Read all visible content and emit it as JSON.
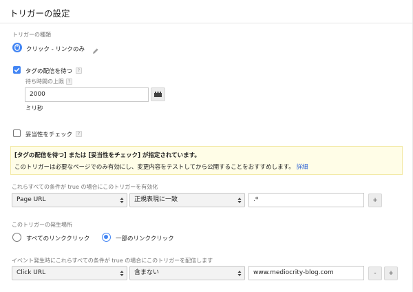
{
  "header": {
    "title": "トリガーの設定"
  },
  "trigger_type": {
    "section_label": "トリガーの種類",
    "value": "クリック - リンクのみ"
  },
  "wait_for_tags": {
    "label": "タグの配信を待つ",
    "checked": true,
    "max_wait_label": "待ち時間の上限",
    "max_wait_value": "2000",
    "unit": "ミリ秒"
  },
  "check_validation": {
    "label": "妥当性をチェック",
    "checked": false
  },
  "help_mark": "?",
  "notice": {
    "title": "[タグの配信を待つ] または [妥当性をチェック] が指定されています。",
    "body": "このトリガーは必要なページでのみ有効にし、変更内容をテストしてから公開することをおすすめします。",
    "link": "詳細"
  },
  "enable_conditions": {
    "label": "これらすべての条件が true の場合にこのトリガーを有効化",
    "variable": "Page URL",
    "operator": "正規表現に一致",
    "value": ".*",
    "add_label": "+"
  },
  "fire_on": {
    "label": "このトリガーの発生場所",
    "options": [
      "すべてのリンククリック",
      "一部のリンククリック"
    ],
    "selected_index": 1
  },
  "fire_conditions": {
    "label": "イベント発生時にこれらすべての条件が true の場合にこのトリガーを配信します",
    "variable": "Click URL",
    "operator": "含まない",
    "value": "www.mediocrity-blog.com",
    "remove_label": "-",
    "add_label": "+"
  },
  "colors": {
    "accent": "#4285f4",
    "link": "#3367d6",
    "notice_bg": "#fffde7"
  }
}
